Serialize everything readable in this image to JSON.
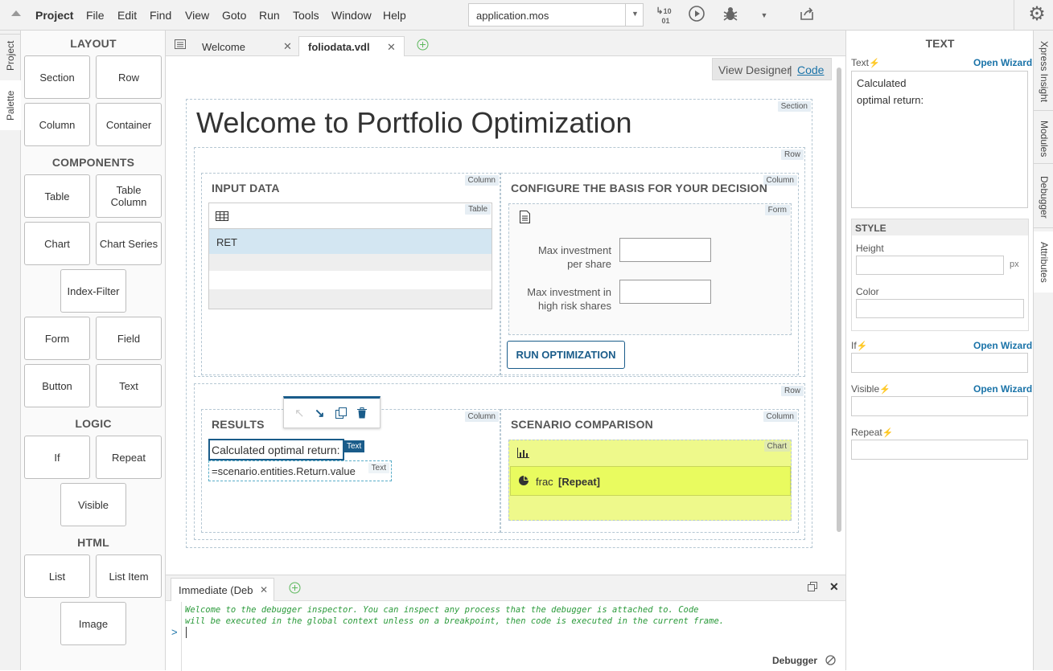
{
  "menubar": {
    "items": [
      "Project",
      "File",
      "Edit",
      "Find",
      "View",
      "Goto",
      "Run",
      "Tools",
      "Window",
      "Help"
    ],
    "app_select": "application.mos"
  },
  "left_tabs": [
    "Project",
    "Palette"
  ],
  "palette": {
    "layout_head": "LAYOUT",
    "layout": [
      "Section",
      "Row",
      "Column",
      "Container"
    ],
    "components_head": "COMPONENTS",
    "components": [
      "Table",
      "Table Column",
      "Chart",
      "Chart Series",
      "Index-Filter",
      "Form",
      "Field",
      "Button",
      "Text"
    ],
    "logic_head": "LOGIC",
    "logic": [
      "If",
      "Repeat",
      "Visible"
    ],
    "html_head": "HTML",
    "html": [
      "List",
      "List Item",
      "Image"
    ]
  },
  "tabs": [
    {
      "label": "Welcome"
    },
    {
      "label": "foliodata.vdl"
    }
  ],
  "view_switch": {
    "designer": "View Designer",
    "sep": "|",
    "code": "Code"
  },
  "designer": {
    "section_tag": "Section",
    "title": "Welcome to Portfolio Optimization",
    "row_tag": "Row",
    "column_tag": "Column",
    "input_title": "INPUT DATA",
    "table_tag": "Table",
    "table_row": "RET",
    "config_title": "CONFIGURE THE BASIS FOR YOUR DECISION",
    "form_tag": "Form",
    "field1": "Max investment per share",
    "field2": "Max investment in high risk shares",
    "run_button": "RUN OPTIMIZATION",
    "results_title": "RESULTS",
    "text1": "Calculated optimal return:",
    "text_tag": "Text",
    "text2": "=scenario.entities.Return.value",
    "scenario_title": "SCENARIO COMPARISON",
    "chart_tag": "Chart",
    "series_name": "frac",
    "series_repeat": "[Repeat]"
  },
  "bottom": {
    "tab": "Immediate (Deb",
    "console_line1": "Welcome to the debugger inspector. You can inspect any process that the debugger is attached to. Code",
    "console_line2": "will be executed in the global context unless on a breakpoint, then code is executed in the current frame.",
    "prompt": ">",
    "status": "Debugger"
  },
  "right": {
    "header": "TEXT",
    "text_label": "Text",
    "open_wizard": "Open Wizard",
    "text_value": "Calculated\noptimal return:",
    "style_head": "STYLE",
    "height_label": "Height",
    "px": "px",
    "color_label": "Color",
    "if_label": "If",
    "visible_label": "Visible",
    "repeat_label": "Repeat"
  },
  "right_tabs": [
    "Xpress Insight",
    "Modules",
    "Debugger",
    "Attributes"
  ],
  "colors": {
    "accent": "#1a5c8a",
    "link": "#1a73a8",
    "chart_bg": "#eef98b",
    "series_bg": "#e9fb5f",
    "selected_row": "#d3e6f2",
    "bolt": "#f5a000"
  }
}
